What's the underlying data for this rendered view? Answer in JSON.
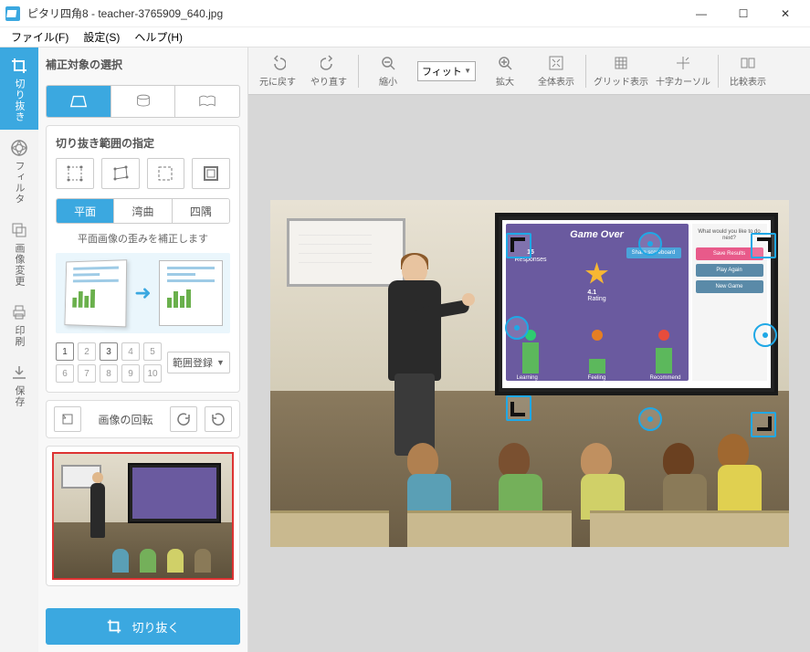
{
  "window": {
    "title": "ピタリ四角8 - teacher-3765909_640.jpg",
    "controls": {
      "minimize": "—",
      "maximize": "☐",
      "close": "✕"
    }
  },
  "menu": {
    "file": "ファイル(F)",
    "settings": "設定(S)",
    "help": "ヘルプ(H)"
  },
  "tabs": {
    "crop": "切り抜き",
    "filter": "フィルタ",
    "transform": "画像変更",
    "print": "印刷",
    "save": "保存"
  },
  "side": {
    "section_title": "補正対象の選択",
    "mode_trapezoid": "trapezoid",
    "mode_cylinder": "cylinder",
    "mode_book": "book",
    "range_title": "切り抜き範囲の指定",
    "surface": {
      "flat": "平面",
      "curved": "湾曲",
      "corners": "四隅"
    },
    "hint": "平面画像の歪みを補正します",
    "slots": [
      "1",
      "2",
      "3",
      "4",
      "5",
      "6",
      "7",
      "8",
      "9",
      "10"
    ],
    "active_slots": [
      0,
      2
    ],
    "range_register": "範囲登録",
    "rotate_label": "画像の回転",
    "crop_button": "切り抜く"
  },
  "toolbar": {
    "undo": "元に戻す",
    "redo": "やり直す",
    "zoom_out": "縮小",
    "fit_select": "フィット",
    "zoom_in": "拡大",
    "fit_all": "全体表示",
    "grid": "グリッド表示",
    "crosshair": "十字カーソル",
    "compare": "比較表示"
  },
  "canvas": {
    "game_title": "Game Over",
    "responses_n": "15",
    "responses_lbl": "Responses",
    "share_btn": "Share scoreboard",
    "rating": "4.1",
    "rating_lbl": "Rating",
    "bar_labels": [
      "Learning",
      "Feeling",
      "Recommend"
    ],
    "side_q": "What would you like to do next?",
    "side_btns": [
      {
        "label": "Save Results",
        "color": "#e85a8a"
      },
      {
        "label": "Play Again",
        "color": "#5a8aa8"
      },
      {
        "label": "New Game",
        "color": "#5a8aa8"
      }
    ]
  }
}
